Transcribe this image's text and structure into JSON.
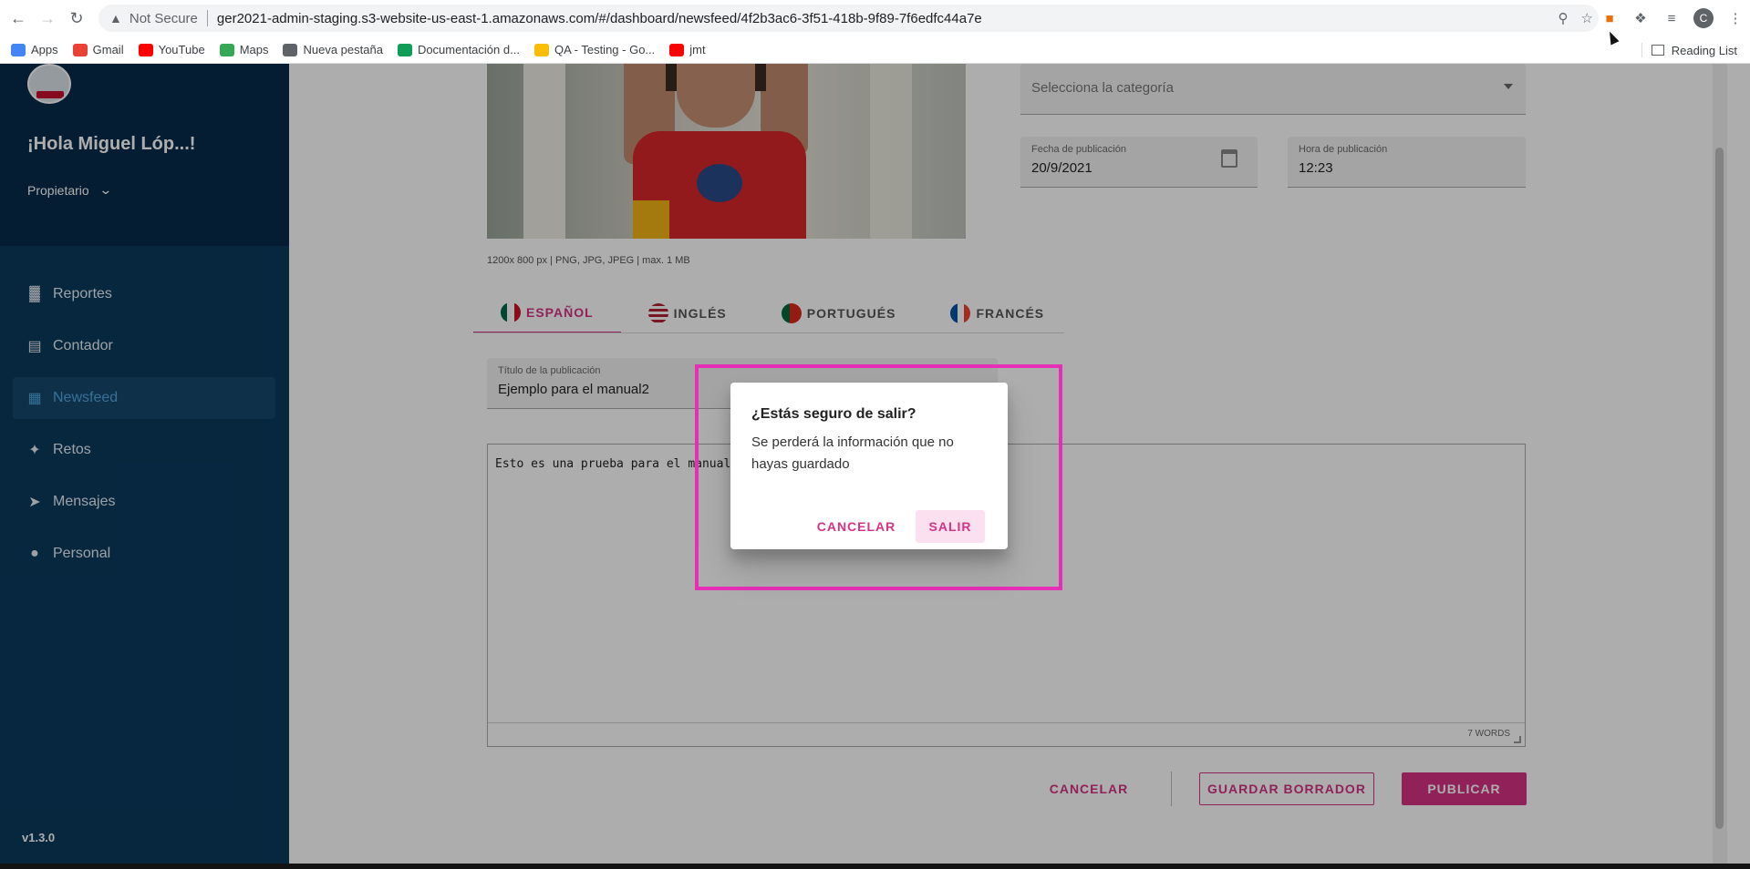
{
  "browser": {
    "security": "Not Secure",
    "url": "ger2021-admin-staging.s3-website-us-east-1.amazonaws.com/#/dashboard/newsfeed/4f2b3ac6-3f51-418b-9f89-7f6edfc44a7e",
    "profile_initial": "C",
    "bookmarks": [
      {
        "label": "Apps",
        "color": "#4285f4"
      },
      {
        "label": "Gmail",
        "color": "#ea4335"
      },
      {
        "label": "YouTube",
        "color": "#ff0000"
      },
      {
        "label": "Maps",
        "color": "#34a853"
      },
      {
        "label": "Nueva pestaña",
        "color": "#5f6368"
      },
      {
        "label": "Documentación d...",
        "color": "#0f9d58"
      },
      {
        "label": "QA - Testing - Go...",
        "color": "#fbbc04"
      },
      {
        "label": "jmt",
        "color": "#ff0000"
      }
    ],
    "reading_list": "Reading List"
  },
  "sidebar": {
    "greeting": "¡Hola Miguel Lóp...!",
    "role": "Propietario",
    "items": [
      {
        "label": "Reportes",
        "icon": "bar-chart-icon"
      },
      {
        "label": "Contador",
        "icon": "counter-icon"
      },
      {
        "label": "Newsfeed",
        "icon": "newsfeed-icon",
        "active": true
      },
      {
        "label": "Retos",
        "icon": "medal-icon"
      },
      {
        "label": "Mensajes",
        "icon": "send-icon"
      },
      {
        "label": "Personal",
        "icon": "person-icon"
      }
    ],
    "version": "v1.3.0"
  },
  "form": {
    "image_hint": "1200x 800 px | PNG, JPG, JPEG | max. 1 MB",
    "category_placeholder": "Selecciona la categoría",
    "date_label": "Fecha de publicación",
    "date_value": "20/9/2021",
    "time_label": "Hora de publicación",
    "time_value": "12:23",
    "tabs": [
      "ESPAÑOL",
      "INGLÉS",
      "PORTUGUÉS",
      "FRANCÉS"
    ],
    "title_label": "Título de la publicación",
    "title_value": "Ejemplo para el manual2",
    "body_text": "Esto es una prueba para el manual;",
    "word_count": "7 WORDS",
    "cancel": "CANCELAR",
    "save_draft": "GUARDAR BORRADOR",
    "publish": "PUBLICAR"
  },
  "dialog": {
    "title": "¿Estás seguro de salir?",
    "message": "Se perderá la información que no hayas guardado",
    "cancel": "CANCELAR",
    "confirm": "SALIR"
  },
  "colors": {
    "accent": "#d63384",
    "sidebar": "#0b3a5e",
    "highlight": "#e62fb5"
  }
}
